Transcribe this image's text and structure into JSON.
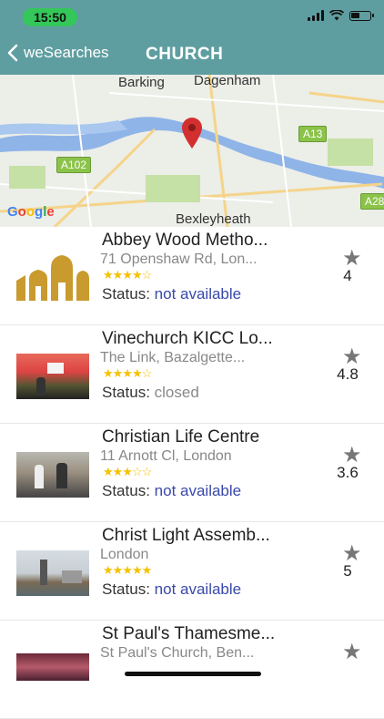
{
  "status_bar": {
    "time": "15:50"
  },
  "header": {
    "back_label": "weSearches",
    "title": "CHURCH"
  },
  "map": {
    "labels": [
      "Barking",
      "Dagenham",
      "Bexleyheath"
    ],
    "roads": [
      "A102",
      "A13",
      "A28"
    ],
    "attribution": "Google",
    "pin_color": "#d32f2f"
  },
  "results": [
    {
      "name": "Abbey Wood Metho...",
      "address": "71 Openshaw Rd, Lon...",
      "stars": "★★★★☆",
      "status_label": "Status:",
      "status_value": "not available",
      "rating": "4"
    },
    {
      "name": "Vinechurch KICC Lo...",
      "address": "The Link, Bazalgette...",
      "stars": "★★★★☆",
      "status_label": "Status:",
      "status_value": "closed",
      "rating": "4.8"
    },
    {
      "name": "Christian Life Centre",
      "address": "11 Arnott Cl, London",
      "stars": "★★★☆☆",
      "status_label": "Status:",
      "status_value": "not available",
      "rating": "3.6"
    },
    {
      "name": "Christ Light Assemb...",
      "address": "London",
      "stars": "★★★★★",
      "status_label": "Status:",
      "status_value": "not available",
      "rating": "5"
    },
    {
      "name": "St Paul's Thamesme...",
      "address": "St Paul's Church, Ben...",
      "stars": "",
      "status_label": "",
      "status_value": "",
      "rating": ""
    }
  ],
  "colors": {
    "header": "#5f9ea0",
    "status_available": "#3949ab",
    "star": "#f5c200"
  }
}
